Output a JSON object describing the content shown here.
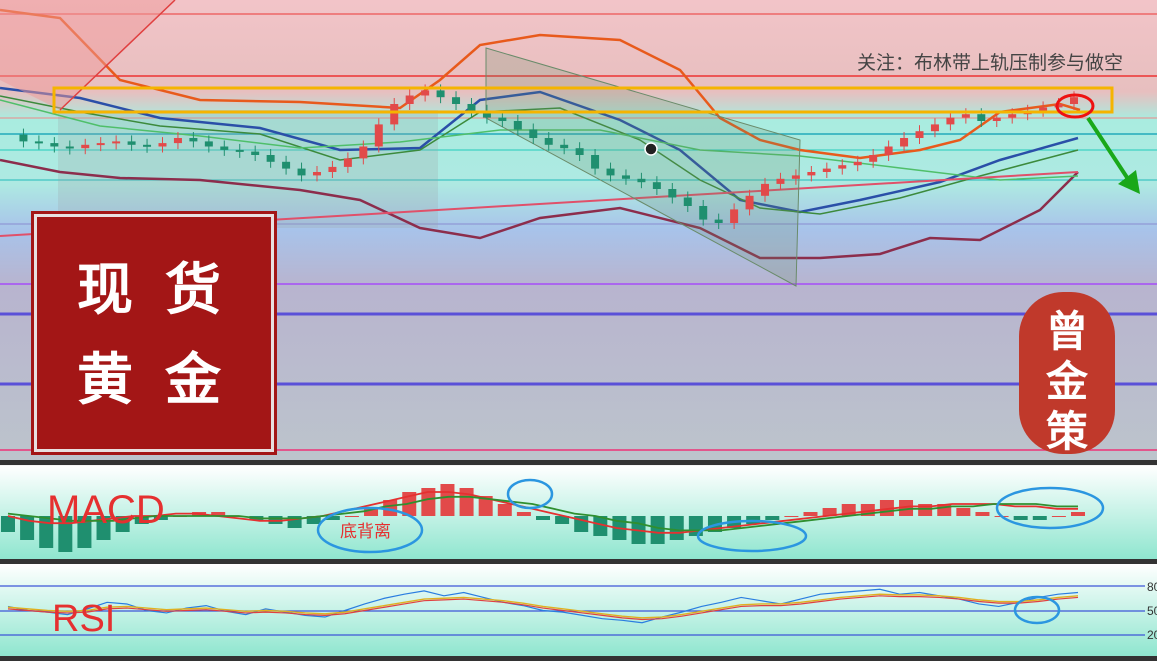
{
  "note": "关注：布林带上轨压制参与做空",
  "seal_left": {
    "chars": [
      "现",
      "货",
      "黄",
      "金"
    ]
  },
  "seal_right": {
    "chars": [
      "曾",
      "金",
      "策"
    ]
  },
  "macd": {
    "label": "MACD",
    "annotation": "底背离"
  },
  "rsi": {
    "label": "RSI",
    "levels": [
      "80",
      "50",
      "20"
    ]
  },
  "colors": {
    "candle_up": "#e24a4a",
    "candle_down": "#1f8f6f",
    "boll_upper": "#e85a1c",
    "boll_lower": "#8c2d4c",
    "macd_dif": "#e53030",
    "macd_dea": "#2f8f2f",
    "highlight_box": "#f5b400",
    "arrow": "#1aa81a",
    "circle_marker": "#2b96e0"
  },
  "chart_data": [
    {
      "type": "candlestick",
      "title": "",
      "annotations": [
        "关注：布林带上轨压制参与做空"
      ],
      "price_series_close": [
        62,
        58,
        57,
        55,
        54,
        56,
        57,
        58,
        56,
        55,
        57,
        60,
        58,
        55,
        53,
        52,
        50,
        46,
        42,
        38,
        40,
        43,
        48,
        55,
        68,
        80,
        85,
        88,
        84,
        80,
        76,
        72,
        70,
        65,
        60,
        56,
        54,
        50,
        42,
        38,
        36,
        34,
        30,
        25,
        20,
        12,
        10,
        18,
        26,
        33,
        36,
        38,
        40,
        42,
        44,
        46,
        50,
        55,
        60,
        64,
        68,
        72,
        74,
        70,
        72,
        74,
        76,
        78,
        80,
        84
      ]
    },
    {
      "type": "bar",
      "title": "MACD",
      "annotations": [
        "底背离"
      ],
      "histogram": [
        -4,
        -6,
        -8,
        -9,
        -8,
        -6,
        -4,
        -2,
        -1,
        0,
        1,
        1,
        0,
        -1,
        -2,
        -3,
        -2,
        -1,
        0,
        2,
        4,
        6,
        7,
        8,
        7,
        5,
        3,
        1,
        -1,
        -2,
        -4,
        -5,
        -6,
        -7,
        -7,
        -6,
        -5,
        -4,
        -3,
        -2,
        -1,
        0,
        1,
        2,
        3,
        3,
        4,
        4,
        3,
        3,
        2,
        1,
        0,
        -1,
        -1,
        0,
        1
      ],
      "dif": [
        0,
        -2,
        -3,
        -3,
        -2,
        -1,
        0,
        0,
        1,
        1,
        0,
        -1,
        -2,
        -2,
        -1,
        0,
        2,
        4,
        6,
        8,
        10,
        10,
        9,
        7,
        5,
        3,
        1,
        -1,
        -3,
        -5,
        -6,
        -7,
        -7,
        -6,
        -5,
        -4,
        -3,
        -2,
        -1,
        0,
        1,
        2,
        3,
        4,
        4,
        5,
        5,
        5,
        4,
        4,
        3,
        3
      ],
      "dea": [
        1,
        0,
        -1,
        -2,
        -2,
        -2,
        -1,
        0,
        0,
        0,
        0,
        0,
        -1,
        -1,
        -1,
        0,
        1,
        2,
        4,
        5,
        7,
        8,
        8,
        7,
        6,
        5,
        3,
        1,
        0,
        -2,
        -3,
        -5,
        -6,
        -6,
        -6,
        -5,
        -4,
        -3,
        -2,
        -1,
        0,
        1,
        2,
        3,
        3,
        4,
        4,
        5,
        5,
        5,
        4,
        4
      ]
    },
    {
      "type": "line",
      "title": "RSI",
      "yticks": [
        "80",
        "50",
        "20"
      ],
      "ylim": [
        0,
        100
      ],
      "series": [
        {
          "values": [
            55,
            50,
            48,
            45,
            52,
            60,
            58,
            50,
            47,
            53,
            56,
            49,
            45,
            52,
            48,
            44,
            42,
            50,
            58,
            65,
            70,
            74,
            68,
            72,
            66,
            60,
            56,
            50,
            48,
            44,
            40,
            38,
            35,
            42,
            48,
            55,
            60,
            66,
            62,
            58,
            64,
            70,
            72,
            74,
            76,
            70,
            72,
            68,
            64,
            58,
            55,
            60,
            66,
            70,
            72
          ]
        },
        {
          "values": [
            54,
            52,
            50,
            49,
            50,
            54,
            55,
            53,
            51,
            52,
            53,
            51,
            49,
            50,
            49,
            47,
            46,
            48,
            52,
            56,
            60,
            64,
            65,
            66,
            64,
            62,
            59,
            55,
            52,
            49,
            46,
            43,
            41,
            42,
            45,
            49,
            53,
            57,
            58,
            58,
            60,
            63,
            66,
            68,
            70,
            69,
            69,
            68,
            66,
            63,
            61,
            61,
            63,
            66,
            68
          ]
        }
      ]
    }
  ]
}
